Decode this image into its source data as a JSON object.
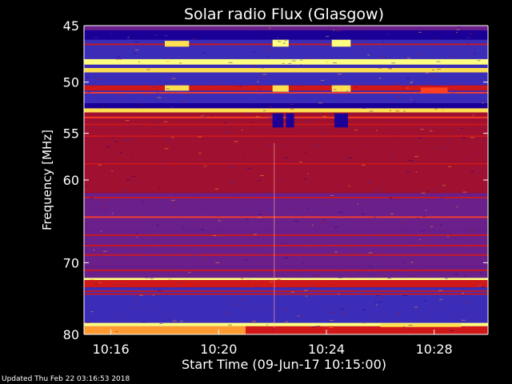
{
  "chart_data": {
    "type": "heatmap",
    "title": "Solar radio Flux (Glasgow)",
    "xlabel": "Start Time (09-Jun-17 10:15:00)",
    "ylabel": "Frequency [MHz]",
    "x_ticks": [
      "10:16",
      "10:20",
      "10:24",
      "10:28"
    ],
    "x_tick_minutes": [
      16,
      20,
      24,
      28
    ],
    "x_range_minutes": [
      15.0,
      30.0
    ],
    "y_ticks": [
      45,
      50,
      55,
      60,
      70,
      80
    ],
    "y_range_mhz": [
      45,
      80
    ],
    "y_scale": "log",
    "colormap": [
      "#1a0096",
      "#3c2db8",
      "#6a1f8a",
      "#a01030",
      "#d01818",
      "#ff4020",
      "#ff9a30",
      "#ffe050",
      "#ffff80"
    ],
    "bands_mhz": [
      {
        "from": 45.0,
        "to": 45.4,
        "level": 0.3
      },
      {
        "from": 45.4,
        "to": 46.2,
        "level": 0.05
      },
      {
        "from": 46.2,
        "to": 47.9,
        "level": 0.12
      },
      {
        "from": 47.9,
        "to": 48.4,
        "level": 0.95
      },
      {
        "from": 48.4,
        "to": 48.7,
        "level": 0.1
      },
      {
        "from": 48.7,
        "to": 49.1,
        "level": 0.9
      },
      {
        "from": 49.1,
        "to": 50.3,
        "level": 0.12
      },
      {
        "from": 50.3,
        "to": 50.8,
        "level": 0.55
      },
      {
        "from": 50.8,
        "to": 52.0,
        "level": 0.1
      },
      {
        "from": 52.0,
        "to": 52.5,
        "level": 0.03
      },
      {
        "from": 52.5,
        "to": 52.9,
        "level": 0.85
      },
      {
        "from": 52.9,
        "to": 55.5,
        "level": 0.4
      },
      {
        "from": 55.5,
        "to": 58.0,
        "level": 0.36
      },
      {
        "from": 58.0,
        "to": 61.5,
        "level": 0.32
      },
      {
        "from": 61.5,
        "to": 66.0,
        "level": 0.26
      },
      {
        "from": 66.0,
        "to": 70.5,
        "level": 0.24
      },
      {
        "from": 70.5,
        "to": 72.0,
        "level": 0.2
      },
      {
        "from": 72.0,
        "to": 72.3,
        "level": 0.95
      },
      {
        "from": 72.3,
        "to": 73.3,
        "level": 0.55
      },
      {
        "from": 73.3,
        "to": 78.3,
        "level": 0.12
      },
      {
        "from": 78.3,
        "to": 78.8,
        "level": 0.98
      },
      {
        "from": 78.8,
        "to": 80.0,
        "level": 0.8
      }
    ],
    "lines_mhz": [
      {
        "mhz": 46.6,
        "level": 0.55
      },
      {
        "mhz": 51.0,
        "level": 0.6
      },
      {
        "mhz": 53.4,
        "level": 0.6
      },
      {
        "mhz": 54.1,
        "level": 0.55
      },
      {
        "mhz": 55.3,
        "level": 0.5
      },
      {
        "mhz": 58.2,
        "level": 0.45
      },
      {
        "mhz": 62.0,
        "level": 0.55
      },
      {
        "mhz": 64.3,
        "level": 0.6
      },
      {
        "mhz": 66.5,
        "level": 0.5
      },
      {
        "mhz": 67.8,
        "level": 0.5
      },
      {
        "mhz": 69.0,
        "level": 0.5
      },
      {
        "mhz": 71.0,
        "level": 0.55
      },
      {
        "mhz": 73.8,
        "level": 0.45
      },
      {
        "mhz": 74.2,
        "level": 0.45
      }
    ],
    "bursts": [
      {
        "t_from": 18.0,
        "t_to": 18.9,
        "f_from": 46.3,
        "f_to": 46.8,
        "level": 0.9
      },
      {
        "t_from": 18.0,
        "t_to": 18.9,
        "f_from": 50.3,
        "f_to": 50.8,
        "level": 0.85
      },
      {
        "t_from": 22.0,
        "t_to": 22.6,
        "f_from": 46.2,
        "f_to": 46.8,
        "level": 0.95
      },
      {
        "t_from": 22.0,
        "t_to": 22.6,
        "f_from": 50.3,
        "f_to": 50.9,
        "level": 0.9
      },
      {
        "t_from": 22.0,
        "t_to": 22.4,
        "f_from": 53.0,
        "f_to": 54.4,
        "level": 0.05
      },
      {
        "t_from": 22.5,
        "t_to": 22.8,
        "f_from": 53.0,
        "f_to": 54.4,
        "level": 0.05
      },
      {
        "t_from": 24.2,
        "t_to": 24.9,
        "f_from": 46.2,
        "f_to": 46.8,
        "level": 0.95
      },
      {
        "t_from": 24.2,
        "t_to": 24.9,
        "f_from": 50.3,
        "f_to": 50.9,
        "level": 0.85
      },
      {
        "t_from": 24.3,
        "t_to": 24.8,
        "f_from": 53.0,
        "f_to": 54.4,
        "level": 0.05
      },
      {
        "t_from": 27.5,
        "t_to": 28.5,
        "f_from": 50.5,
        "f_to": 51.0,
        "level": 0.65
      },
      {
        "t_from": 21.0,
        "t_to": 30.0,
        "f_from": 78.8,
        "f_to": 80.0,
        "level": 0.55
      },
      {
        "t_from": 26.0,
        "t_to": 29.0,
        "f_from": 78.4,
        "f_to": 78.9,
        "level": 0.85
      }
    ],
    "grid": false,
    "legend": "none"
  },
  "footer": {
    "text": "Updated Thu Feb 22 03:16:53 2018"
  }
}
